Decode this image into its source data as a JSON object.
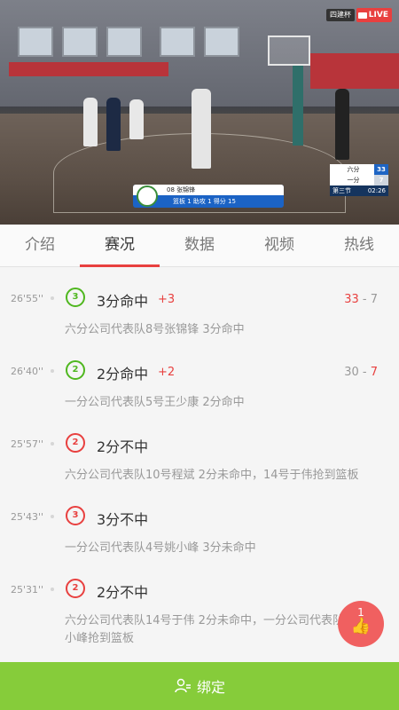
{
  "video": {
    "cup_tag": "四建杯",
    "live_label": "LIVE",
    "lower_third": {
      "player": "08  张锦锋",
      "stats": "篮板  1     助攻  1     得分  15"
    },
    "scoreboard": {
      "team_a": "六分",
      "score_a": "33",
      "team_b": "一分",
      "score_b": "7",
      "period": "第三节",
      "clock": "02:26"
    }
  },
  "tabs": [
    {
      "label": "介绍",
      "active": false
    },
    {
      "label": "赛况",
      "active": true
    },
    {
      "label": "数据",
      "active": false
    },
    {
      "label": "视频",
      "active": false
    },
    {
      "label": "热线",
      "active": false
    }
  ],
  "events": [
    {
      "time": "26'55''",
      "icon_text": "3",
      "icon_color": "green",
      "title": "3分命中",
      "plus": "+3",
      "score_a": "33",
      "score_sep": " - ",
      "score_b": "7",
      "highlight": "a",
      "desc": "六分公司代表队8号张锦锋 3分命中"
    },
    {
      "time": "26'40''",
      "icon_text": "2",
      "icon_color": "green",
      "title": "2分命中",
      "plus": "+2",
      "score_a": "30",
      "score_sep": " - ",
      "score_b": "7",
      "highlight": "b",
      "desc": "一分公司代表队5号王少康 2分命中"
    },
    {
      "time": "25'57''",
      "icon_text": "2",
      "icon_color": "red",
      "title": "2分不中",
      "plus": "",
      "score_a": "",
      "score_sep": "",
      "score_b": "",
      "highlight": "",
      "desc": "六分公司代表队10号程斌 2分未命中，14号于伟抢到篮板"
    },
    {
      "time": "25'43''",
      "icon_text": "3",
      "icon_color": "red",
      "title": "3分不中",
      "plus": "",
      "score_a": "",
      "score_sep": "",
      "score_b": "",
      "highlight": "",
      "desc": "一分公司代表队4号姚小峰 3分未命中"
    },
    {
      "time": "25'31''",
      "icon_text": "2",
      "icon_color": "red",
      "title": "2分不中",
      "plus": "",
      "score_a": "",
      "score_sep": "",
      "score_b": "",
      "highlight": "",
      "desc": "六分公司代表队14号于伟 2分未命中，一分公司代表队4号姚小峰抢到篮板"
    }
  ],
  "like": {
    "count": "1",
    "icon": "thumbs-up-icon"
  },
  "bind_button": {
    "label": "绑定",
    "icon": "person-bind-icon"
  },
  "colors": {
    "accent": "#e8403f",
    "green": "#86cc3a",
    "hit": "#4fb71f"
  }
}
